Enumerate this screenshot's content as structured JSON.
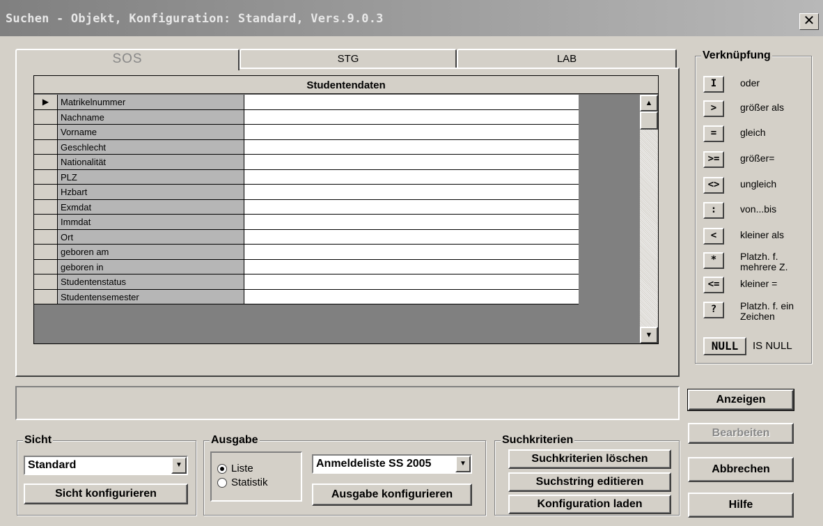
{
  "window": {
    "title": "Suchen - Objekt, Konfiguration: Standard, Vers.9.0.3",
    "close_label": "✕"
  },
  "tabs": [
    {
      "label": "SOS"
    },
    {
      "label": "STG"
    },
    {
      "label": "LAB"
    }
  ],
  "grid": {
    "header": "Studentendaten",
    "current_indicator": "▶",
    "rows": [
      {
        "label": "Matrikelnummer",
        "value": ""
      },
      {
        "label": "Nachname",
        "value": ""
      },
      {
        "label": "Vorname",
        "value": ""
      },
      {
        "label": "Geschlecht",
        "value": ""
      },
      {
        "label": "Nationalität",
        "value": ""
      },
      {
        "label": "PLZ",
        "value": ""
      },
      {
        "label": "Hzbart",
        "value": ""
      },
      {
        "label": "Exmdat",
        "value": ""
      },
      {
        "label": "Immdat",
        "value": ""
      },
      {
        "label": "Ort",
        "value": ""
      },
      {
        "label": "geboren am",
        "value": ""
      },
      {
        "label": "geboren in",
        "value": ""
      },
      {
        "label": "Studentenstatus",
        "value": ""
      },
      {
        "label": "Studentensemester",
        "value": ""
      }
    ],
    "scroll_up": "▲",
    "scroll_down": "▼"
  },
  "verknuepfung": {
    "legend": "Verknüpfung",
    "items": [
      {
        "symbol": "I",
        "label": "oder"
      },
      {
        "symbol": ">",
        "label": "größer als"
      },
      {
        "symbol": "=",
        "label": "gleich"
      },
      {
        "symbol": ">=",
        "label": "größer="
      },
      {
        "symbol": "<>",
        "label": "ungleich"
      },
      {
        "symbol": ":",
        "label": "von...bis"
      },
      {
        "symbol": "<",
        "label": "kleiner als"
      },
      {
        "symbol": "*",
        "label": "Platzh. f. mehrere Z."
      },
      {
        "symbol": "<=",
        "label": "kleiner ="
      },
      {
        "symbol": "?",
        "label": "Platzh. f. ein Zeichen"
      }
    ],
    "null_symbol": "NULL",
    "null_label": "IS NULL"
  },
  "buttons": {
    "anzeigen": "Anzeigen",
    "bearbeiten": "Bearbeiten",
    "abbrechen": "Abbrechen",
    "hilfe": "Hilfe"
  },
  "sicht": {
    "legend": "Sicht",
    "selected": "Standard",
    "configure": "Sicht konfigurieren"
  },
  "ausgabe": {
    "legend": "Ausgabe",
    "radio_liste": "Liste",
    "radio_statistik": "Statistik",
    "selected_radio": "Liste",
    "selected_list": "Anmeldeliste SS 2005",
    "configure": "Ausgabe konfigurieren"
  },
  "suchkriterien": {
    "legend": "Suchkriterien",
    "loeschen": "Suchkriterien löschen",
    "editieren": "Suchstring editieren",
    "laden": "Konfiguration laden"
  }
}
